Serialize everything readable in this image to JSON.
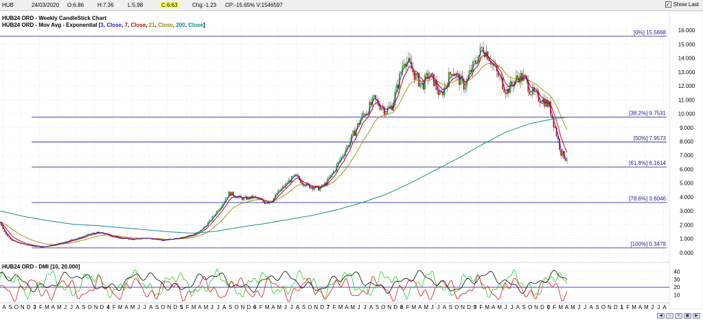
{
  "header": {
    "symbol": "HUB",
    "date": "24/03/2020",
    "open": "O:6.86",
    "high": "H:7.36",
    "low": "L:5.98",
    "close": "C:6.63",
    "change": "Chg:-1.23",
    "change_pct_volume": "CP:-15.65% V:1546597",
    "show_last_label": "Show Last",
    "show_last_checked": true
  },
  "legend": {
    "line1": "HUB24 ORD - Weekly CandleStick Chart",
    "line2_prefix": "HUB24 ORD - Mov Avg - Exponential [",
    "ma_params": [
      {
        "text": "3",
        "color": "#1a1acc"
      },
      {
        "text": "Close",
        "color": "#1a1acc"
      },
      {
        "text": "7",
        "color": "#cc0000"
      },
      {
        "text": "Close",
        "color": "#cc0000"
      },
      {
        "text": "21",
        "color": "#998800"
      },
      {
        "text": "Close",
        "color": "#998800"
      },
      {
        "text": "200",
        "color": "#008888"
      },
      {
        "text": "Close",
        "color": "#008888"
      }
    ],
    "line2_suffix": "]"
  },
  "dmi_title": "HUB24 ORD - DMI [10, 20.000]",
  "colors": {
    "bull": "#22aa22",
    "bear": "#dd1111",
    "ema3": "#1a1acc",
    "ema7": "#cc0000",
    "ema21": "#998800",
    "ema200": "#1a8a8a",
    "fib": "#303090",
    "dmi_plus": "#22cc22",
    "dmi_minus": "#dd1111",
    "adx": "#000000",
    "dmi_threshold": "#3030cc"
  },
  "chart_data": {
    "type": "line",
    "title": "HUB24 ORD - Weekly CandleStick Chart",
    "y_ticks": [
      "16.000",
      "15.000",
      "14.000",
      "13.000",
      "12.000",
      "11.000",
      "10.000",
      "9.000",
      "8.000",
      "7.000",
      "6.000",
      "5.000",
      "4.000",
      "3.000",
      "2.000",
      "1.000",
      "0.000"
    ],
    "ylim": [
      -0.3,
      16.3
    ],
    "fib_levels": [
      {
        "label": "[0%] 15.5668",
        "value": 15.5668
      },
      {
        "label": "[38.2%] 9.7531",
        "value": 9.7531
      },
      {
        "label": "[50%] 7.9573",
        "value": 7.9573
      },
      {
        "label": "[61.8%] 6.1614",
        "value": 6.1614
      },
      {
        "label": "[78.6%] 3.6046",
        "value": 3.6046
      },
      {
        "label": "[100%] 0.3478",
        "value": 0.3478
      }
    ],
    "x_month_labels": [
      "A",
      "S",
      "O",
      "N",
      "D",
      "3",
      "F",
      "M",
      "A",
      "M",
      "J",
      "J",
      "A",
      "S",
      "O",
      "N",
      "D",
      "4",
      "F",
      "M",
      "A",
      "M",
      "J",
      "J",
      "A",
      "S",
      "O",
      "N",
      "D",
      "5",
      "F",
      "M",
      "A",
      "M",
      "J",
      "J",
      "A",
      "S",
      "O",
      "N",
      "D",
      "6",
      "F",
      "M",
      "A",
      "M",
      "J",
      "J",
      "A",
      "S",
      "O",
      "N",
      "D",
      "7",
      "F",
      "M",
      "A",
      "M",
      "J",
      "J",
      "A",
      "S",
      "O",
      "N",
      "D",
      "8",
      "F",
      "M",
      "A",
      "M",
      "J",
      "J",
      "A",
      "S",
      "O",
      "N",
      "D",
      "9",
      "F",
      "M",
      "A",
      "M",
      "J",
      "J",
      "A",
      "S",
      "O",
      "N",
      "D",
      "0",
      "F",
      "M",
      "A",
      "M",
      "J",
      "J",
      "A",
      "S",
      "O",
      "N",
      "D",
      "1",
      "F",
      "M",
      "A",
      "M",
      "J",
      "J",
      "A"
    ],
    "x_year_labels": [
      "3",
      "4",
      "5",
      "6",
      "7",
      "8",
      "9",
      "0",
      "1"
    ],
    "price_path": [
      [
        0,
        2.2
      ],
      [
        1,
        1.3
      ],
      [
        2,
        0.9
      ],
      [
        3,
        0.7
      ],
      [
        4,
        0.6
      ],
      [
        5,
        0.5
      ],
      [
        6,
        0.45
      ],
      [
        7,
        0.4
      ],
      [
        8,
        0.5
      ],
      [
        9,
        0.55
      ],
      [
        10,
        0.7
      ],
      [
        11,
        0.8
      ],
      [
        12,
        0.95
      ],
      [
        13,
        1.05
      ],
      [
        14,
        1.2
      ],
      [
        15,
        1.35
      ],
      [
        16,
        1.45
      ],
      [
        17,
        1.4
      ],
      [
        18,
        1.25
      ],
      [
        19,
        1.1
      ],
      [
        20,
        1.05
      ],
      [
        21,
        1.0
      ],
      [
        22,
        0.95
      ],
      [
        23,
        1.0
      ],
      [
        24,
        1.05
      ],
      [
        25,
        1.0
      ],
      [
        26,
        0.95
      ],
      [
        27,
        0.9
      ],
      [
        28,
        0.95
      ],
      [
        29,
        1.0
      ],
      [
        30,
        1.1
      ],
      [
        31,
        1.2
      ],
      [
        32,
        1.3
      ],
      [
        33,
        1.5
      ],
      [
        34,
        1.9
      ],
      [
        35,
        2.4
      ],
      [
        36,
        3.0
      ],
      [
        37,
        3.6
      ],
      [
        38,
        4.3
      ],
      [
        39,
        4.1
      ],
      [
        40,
        3.9
      ],
      [
        41,
        3.9
      ],
      [
        42,
        4.0
      ],
      [
        43,
        3.8
      ],
      [
        44,
        3.6
      ],
      [
        45,
        3.7
      ],
      [
        46,
        4.3
      ],
      [
        47,
        4.7
      ],
      [
        48,
        5.2
      ],
      [
        49,
        5.5
      ],
      [
        50,
        5.1
      ],
      [
        51,
        4.8
      ],
      [
        52,
        4.7
      ],
      [
        53,
        4.6
      ],
      [
        54,
        5.0
      ],
      [
        55,
        5.6
      ],
      [
        56,
        6.4
      ],
      [
        57,
        7.2
      ],
      [
        58,
        8.0
      ],
      [
        59,
        8.9
      ],
      [
        60,
        9.8
      ],
      [
        61,
        10.3
      ],
      [
        62,
        11.0
      ],
      [
        63,
        10.6
      ],
      [
        64,
        10.2
      ],
      [
        65,
        10.6
      ],
      [
        66,
        12.2
      ],
      [
        67,
        14.0
      ],
      [
        68,
        13.4
      ],
      [
        69,
        12.6
      ],
      [
        70,
        12.0
      ],
      [
        71,
        12.8
      ],
      [
        72,
        12.3
      ],
      [
        73,
        11.2
      ],
      [
        74,
        12.2
      ],
      [
        75,
        13.2
      ],
      [
        76,
        12.5
      ],
      [
        77,
        12.0
      ],
      [
        78,
        13.0
      ],
      [
        79,
        13.9
      ],
      [
        80,
        14.8
      ],
      [
        81,
        14.2
      ],
      [
        82,
        13.2
      ],
      [
        83,
        12.4
      ],
      [
        84,
        11.6
      ],
      [
        85,
        12.2
      ],
      [
        86,
        12.7
      ],
      [
        87,
        12.5
      ],
      [
        88,
        11.6
      ],
      [
        89,
        11.2
      ],
      [
        90,
        11.0
      ],
      [
        91,
        10.6
      ],
      [
        92,
        9.0
      ],
      [
        93,
        7.2
      ],
      [
        94,
        6.63
      ]
    ],
    "ema200_path": [
      [
        0,
        3.0
      ],
      [
        4,
        2.6
      ],
      [
        8,
        2.3
      ],
      [
        12,
        2.05
      ],
      [
        16,
        1.95
      ],
      [
        20,
        1.8
      ],
      [
        24,
        1.65
      ],
      [
        28,
        1.5
      ],
      [
        32,
        1.4
      ],
      [
        36,
        1.55
      ],
      [
        40,
        1.85
      ],
      [
        44,
        2.1
      ],
      [
        48,
        2.4
      ],
      [
        52,
        2.7
      ],
      [
        56,
        3.1
      ],
      [
        60,
        3.6
      ],
      [
        64,
        4.2
      ],
      [
        68,
        5.0
      ],
      [
        72,
        5.9
      ],
      [
        76,
        6.8
      ],
      [
        80,
        7.8
      ],
      [
        84,
        8.7
      ],
      [
        88,
        9.3
      ],
      [
        92,
        9.65
      ],
      [
        94,
        9.75
      ]
    ],
    "dmi_ylim": [
      0,
      50
    ],
    "dmi_ticks": [
      "40",
      "30",
      "20",
      "10"
    ],
    "dmi_threshold": 20
  }
}
